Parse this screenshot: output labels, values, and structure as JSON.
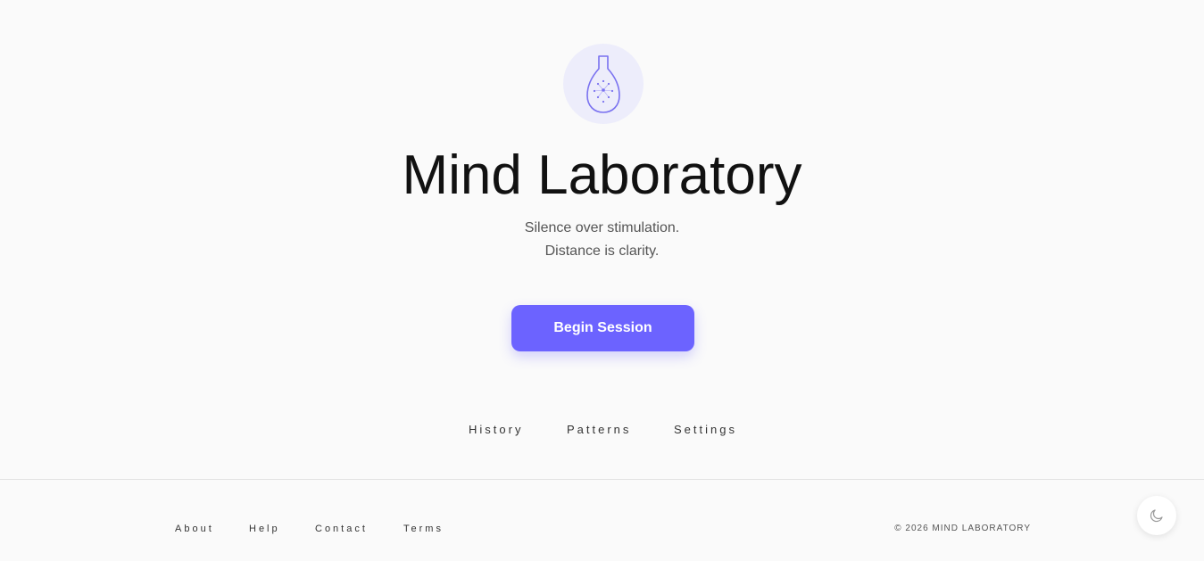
{
  "app": {
    "title": "Mind Laboratory",
    "tagline_line1": "Silence over stimulation.",
    "tagline_line2": "Distance is clarity.",
    "logo_icon": "flask-icon"
  },
  "cta": {
    "label": "Begin Session"
  },
  "nav": {
    "items": [
      {
        "label": "History"
      },
      {
        "label": "Patterns"
      },
      {
        "label": "Settings"
      }
    ]
  },
  "footer": {
    "links": [
      {
        "label": "About"
      },
      {
        "label": "Help"
      },
      {
        "label": "Contact"
      },
      {
        "label": "Terms"
      }
    ],
    "copyright": "© 2026 MIND LABORATORY"
  },
  "theme_toggle": {
    "icon": "moon-icon"
  },
  "colors": {
    "accent": "#6c63ff",
    "logo_bg": "#ededfb",
    "background": "#fafafa",
    "title": "#111111"
  }
}
